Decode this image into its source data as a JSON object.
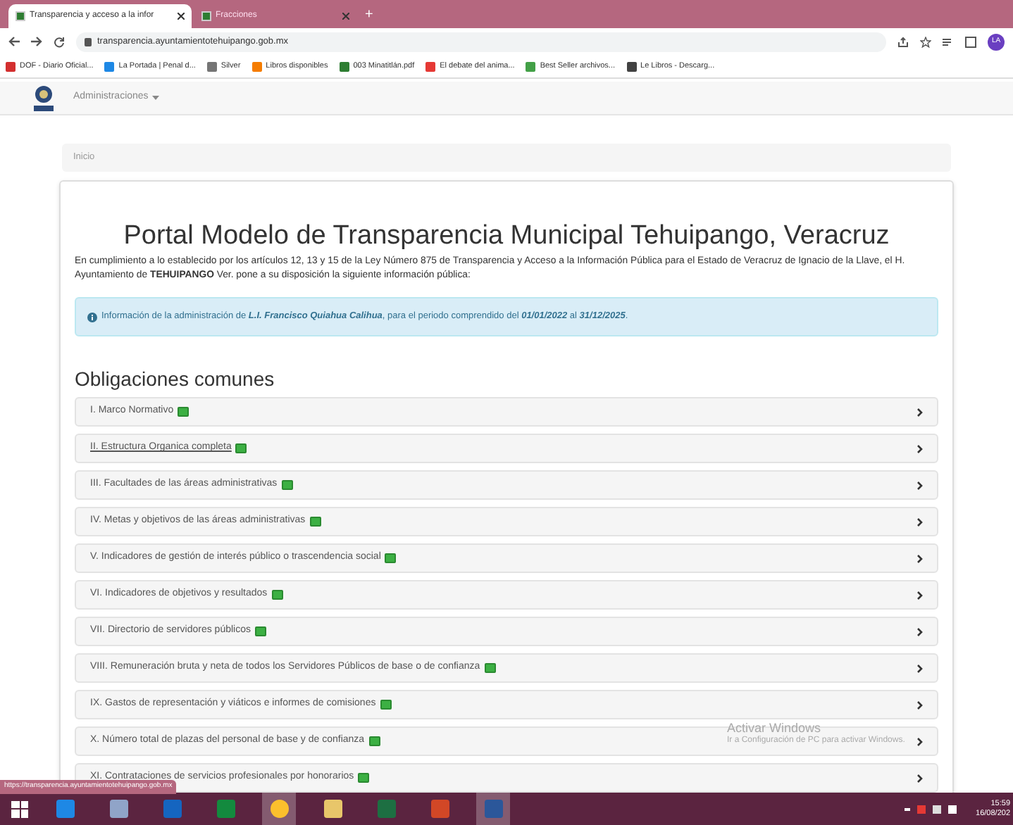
{
  "browser": {
    "tabs": [
      {
        "title": "Transparencia y acceso a la infor",
        "selected": true
      },
      {
        "title": "Fracciones",
        "selected": false
      }
    ],
    "new_tab": "+",
    "url": "transparencia.ayuntamientotehuipango.gob.mx",
    "profile": "LA",
    "bookmarks": [
      {
        "label": "DOF - Diario Oficial...",
        "color": "#d32f2f"
      },
      {
        "label": "La Portada | Penal d...",
        "color": "#1e88e5"
      },
      {
        "label": "Silver",
        "color": "#757575"
      },
      {
        "label": "Libros disponibles",
        "color": "#f57c00"
      },
      {
        "label": "003 Minatitlán.pdf",
        "color": "#2e7d32"
      },
      {
        "label": "El debate del anima...",
        "color": "#e53935"
      },
      {
        "label": "Best Seller archivos...",
        "color": "#43a047"
      },
      {
        "label": "Le Libros - Descarg...",
        "color": "#424242"
      }
    ]
  },
  "navbar": {
    "menu": "Administraciones"
  },
  "breadcrumb": "Inicio",
  "page": {
    "title": "Portal Modelo de Transparencia Municipal Tehuipango, Veracruz",
    "intro": "En cumplimiento a lo establecido por los artículos 12, 13 y 15 de la Ley Número 875 de Transparencia y Acceso a la Información Pública para el Estado de Veracruz de Ignacio de la Llave, el H. Ayuntamiento de **TEHUIPANGO** Ver. pone a su disposición la siguiente información pública:",
    "alert": "Información de la administración de **L.I. Francisco Quiahua Calihua**, para el periodo comprendido del **01/01/2022** al **31/12/2025**.",
    "section": "Obligaciones comunes",
    "items": [
      {
        "label": "I. Marco Normativo",
        "hovered": false
      },
      {
        "label": "II. Estructura Organica completa",
        "hovered": true
      },
      {
        "label": "III. Facultades de las áreas administrativas",
        "hovered": false
      },
      {
        "label": "IV. Metas y objetivos de las áreas administrativas",
        "hovered": false
      },
      {
        "label": "V. Indicadores de gestión de interés público o trascendencia social",
        "hovered": false
      },
      {
        "label": "VI. Indicadores de objetivos y resultados",
        "hovered": false
      },
      {
        "label": "VII. Directorio de servidores públicos",
        "hovered": false
      },
      {
        "label": "VIII. Remuneración bruta y neta de todos los Servidores Públicos de base o de confianza",
        "hovered": false
      },
      {
        "label": "IX. Gastos de representación y viáticos e informes de comisiones",
        "hovered": false
      },
      {
        "label": "X. Número total de plazas del personal de base y de confianza",
        "hovered": false
      },
      {
        "label": "XI. Contrataciones de servicios profesionales por honorarios",
        "hovered": false
      }
    ]
  },
  "activation": {
    "title": "Activar Windows",
    "hint": "Ir a Configuración de PC para activar Windows."
  },
  "status_url": "https://transparencia.ayuntamientotehuipango.gob.mx",
  "taskbar": {
    "apps": [
      {
        "kind": "ie",
        "selected": false
      },
      {
        "kind": "doc",
        "selected": false
      },
      {
        "kind": "outlook",
        "selected": false
      },
      {
        "kind": "publisher",
        "selected": false
      },
      {
        "kind": "chrome",
        "selected": true
      },
      {
        "kind": "files",
        "selected": false
      },
      {
        "kind": "excel",
        "selected": false
      },
      {
        "kind": "powerpoint",
        "selected": false
      },
      {
        "kind": "word",
        "selected": true
      }
    ],
    "time": "15:59",
    "date": "16/08/202"
  }
}
